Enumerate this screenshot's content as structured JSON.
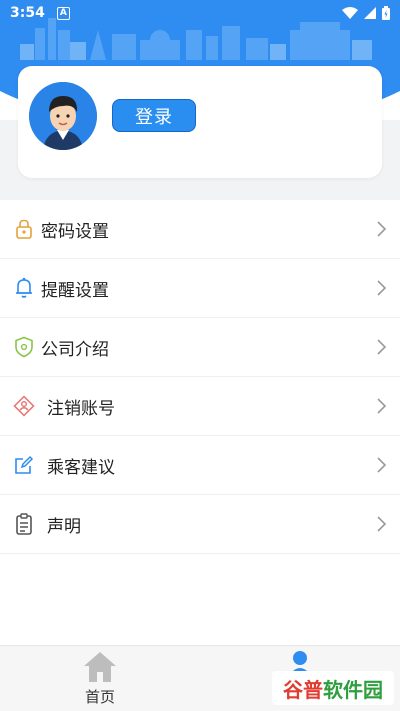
{
  "status_bar": {
    "time": "3:54",
    "notification_letter": "A"
  },
  "profile": {
    "login_label": "登录"
  },
  "menu": [
    {
      "label": "密码设置",
      "icon": "lock-icon",
      "color": "#e6a23c"
    },
    {
      "label": "提醒设置",
      "icon": "bell-icon",
      "color": "#2f8cf0"
    },
    {
      "label": "公司介绍",
      "icon": "shield-icon",
      "color": "#8bc34a"
    },
    {
      "label": "注销账号",
      "icon": "user-cancel-icon",
      "color": "#e57373"
    },
    {
      "label": "乘客建议",
      "icon": "edit-icon",
      "color": "#2f8cf0"
    },
    {
      "label": "声明",
      "icon": "clipboard-icon",
      "color": "#555555"
    }
  ],
  "bottom_nav": {
    "home_label": "首页",
    "mine_label": "我的"
  },
  "watermark": {
    "part1": "谷普",
    "part2": "软件园"
  },
  "colors": {
    "primary": "#2f8cf0",
    "background": "#f2f3f5"
  }
}
